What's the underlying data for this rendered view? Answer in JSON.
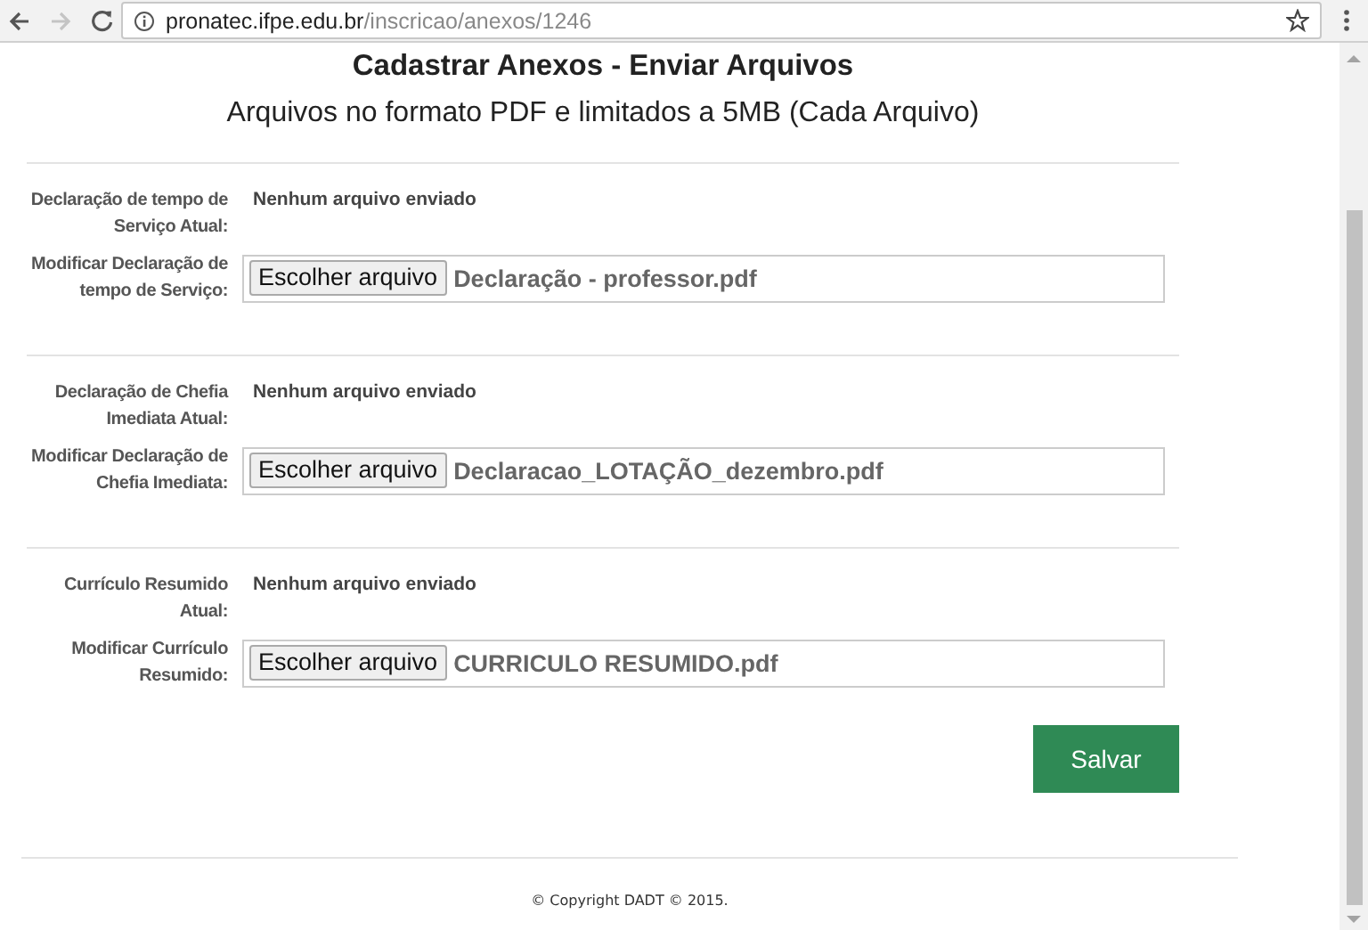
{
  "browser": {
    "url_host": "pronatec.ifpe.edu.br",
    "url_path": "/inscricao/anexos/1246",
    "forward_disabled": true
  },
  "page": {
    "title": "Cadastrar Anexos - Enviar Arquivos",
    "subtitle": "Arquivos no formato PDF e limitados a 5MB (Cada Arquivo)"
  },
  "sections": [
    {
      "current_label": "Declaração de tempo de Serviço Atual:",
      "current_value": "Nenhum arquivo enviado",
      "modify_label": "Modificar Declaração de tempo de Serviço:",
      "button": "Escolher arquivo",
      "file": "Declaração - professor.pdf"
    },
    {
      "current_label": "Declaração de Chefia Imediata Atual:",
      "current_value": "Nenhum arquivo enviado",
      "modify_label": "Modificar Declaração de Chefia Imediata:",
      "button": "Escolher arquivo",
      "file": "Declaracao_LOTAÇÃO_dezembro.pdf"
    },
    {
      "current_label": "Currículo Resumido Atual:",
      "current_value": "Nenhum arquivo enviado",
      "modify_label": "Modificar Currículo Resumido:",
      "button": "Escolher arquivo",
      "file": "CURRICULO RESUMIDO.pdf"
    }
  ],
  "save_button": "Salvar",
  "footer": "© Copyright DADT © 2015."
}
